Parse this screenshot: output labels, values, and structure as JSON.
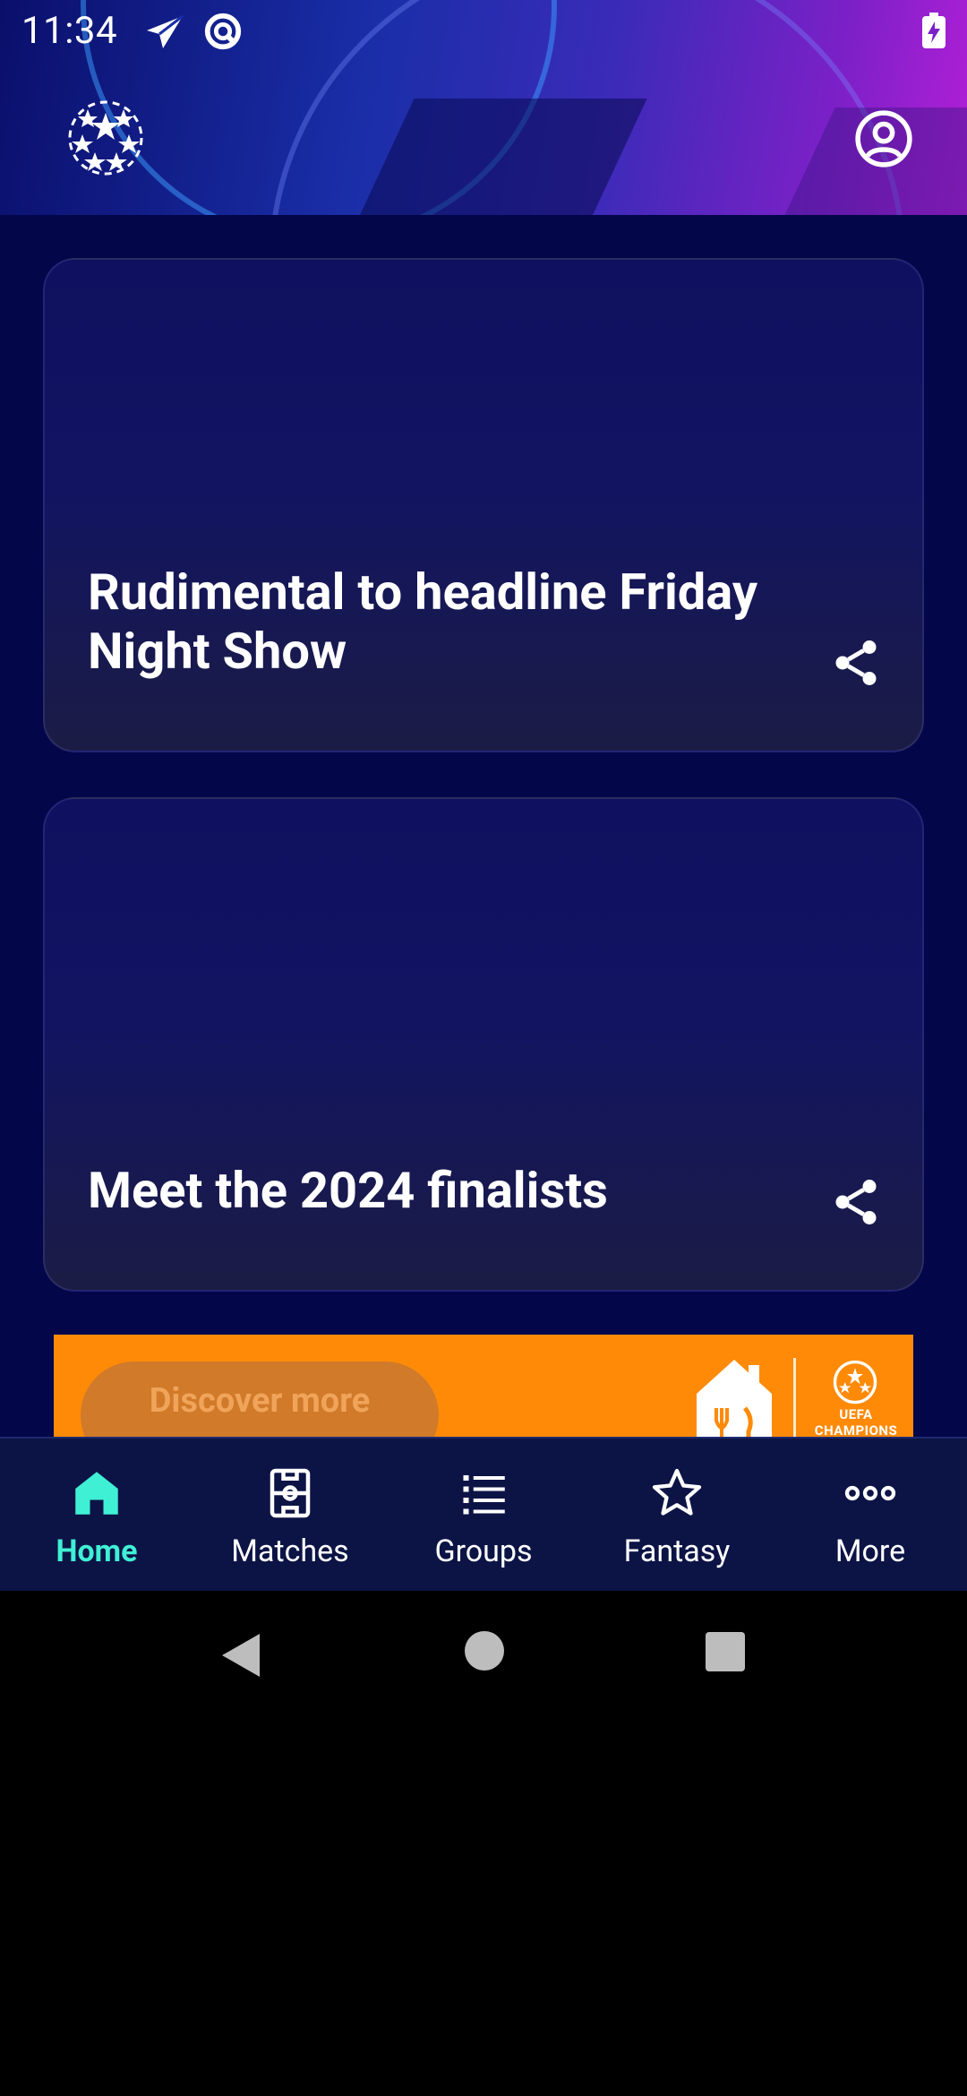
{
  "status_bar": {
    "time": "11:34"
  },
  "cards": [
    {
      "title": "Rudimental to headline Friday Night Show"
    },
    {
      "title": "Meet the 2024 finalists"
    }
  ],
  "banner": {
    "cta_label": "Discover more",
    "ucl_text": "UEFA CHAMPIONS"
  },
  "nav": {
    "items": [
      {
        "label": "Home",
        "icon": "home-icon",
        "active": true
      },
      {
        "label": "Matches",
        "icon": "pitch-icon"
      },
      {
        "label": "Groups",
        "icon": "list-icon"
      },
      {
        "label": "Fantasy",
        "icon": "star-icon"
      },
      {
        "label": "More",
        "icon": "more-icon"
      }
    ]
  },
  "colors": {
    "accent": "#3ff0d4",
    "background": "#04064a",
    "nav_bg": "#0c1446",
    "banner": "#ff8a08"
  }
}
